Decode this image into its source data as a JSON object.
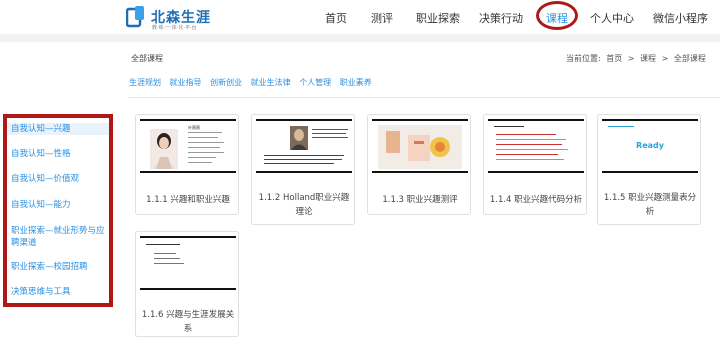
{
  "brand": {
    "name": "北森生涯",
    "slogan": "教·练·一·体·化·平·台"
  },
  "nav": [
    "首页",
    "测评",
    "职业探索",
    "决策行动",
    "课程",
    "个人中心",
    "微信小程序"
  ],
  "nav_active": "课程",
  "page": {
    "section_title": "全部课程"
  },
  "breadcrumb": [
    "当前位置:",
    "首页",
    ">",
    "课程",
    ">",
    "全部课程"
  ],
  "filters": [
    "生涯规划",
    "就业指导",
    "创新创业",
    "就业生法律",
    "个人管理",
    "职业素养"
  ],
  "sidebar": [
    "自我认知—兴趣",
    "自我认知—性格",
    "自我认知—价值观",
    "自我认知—能力",
    "职业探索—就业形势与应聘渠道",
    "职业探索—校园招聘",
    "决策思维与工具"
  ],
  "cards": [
    {
      "title": "1.1.1 兴趣和职业兴趣",
      "thumb_title": "叶薇薇"
    },
    {
      "title": "1.1.2 Holland职业兴趣理论"
    },
    {
      "title": "1.1.3 职业兴趣测评"
    },
    {
      "title": "1.1.4 职业兴趣代码分析"
    },
    {
      "title": "1.1.5 职业兴趣测量表分析",
      "thumb_text": "Ready"
    },
    {
      "title": "1.1.6 兴趣与生涯发展关系"
    }
  ],
  "colors": {
    "accent": "#2a8fe0",
    "highlight_border": "#b01818",
    "brand": "#1c6fb5"
  }
}
